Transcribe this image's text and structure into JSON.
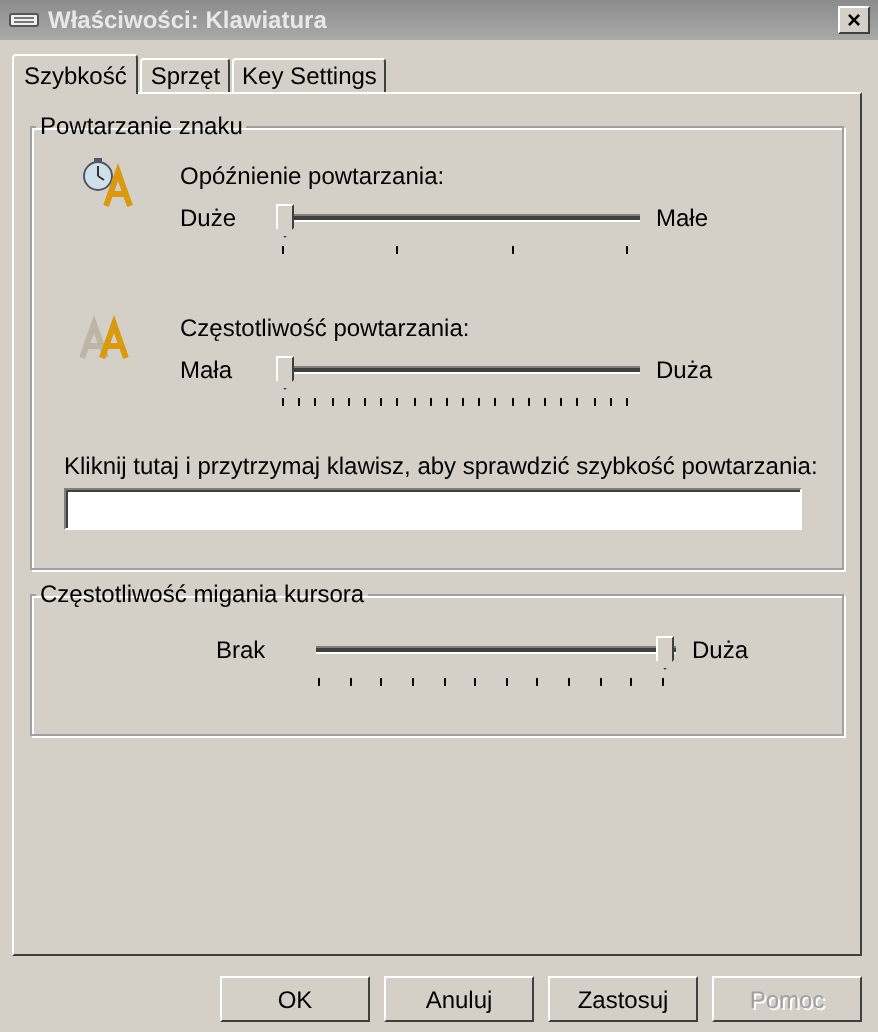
{
  "window": {
    "title": "Właściwości: Klawiatura",
    "close": "×"
  },
  "tabs": [
    {
      "label": "Szybkość",
      "selected": true
    },
    {
      "label": "Sprzęt",
      "selected": false
    },
    {
      "label": "Key Settings",
      "selected": false
    }
  ],
  "repeat_group": {
    "title": "Powtarzanie znaku",
    "sliders": [
      {
        "kind": "delay",
        "label": "Opóźnienie powtarzania:",
        "min_label": "Duże",
        "max_label": "Małe",
        "level": 0
      },
      {
        "kind": "rate",
        "label": "Częstotliwość powtarzania:",
        "min_label": "Mała",
        "max_label": "Duża",
        "level": 0
      }
    ],
    "test_label": "Kliknij tutaj i przytrzymaj klawisz, aby sprawdzić szybkość powtarzania:"
  },
  "cursor_group": {
    "title": "Częstotliwość migania kursora",
    "min_label": "Brak",
    "max_label": "Duża",
    "level": 1
  },
  "buttons": [
    {
      "label": "OK",
      "disabled": false
    },
    {
      "label": "Anuluj",
      "disabled": false
    },
    {
      "label": "Zastosuj",
      "disabled": false
    },
    {
      "label": "Pomoc",
      "disabled": true
    }
  ]
}
